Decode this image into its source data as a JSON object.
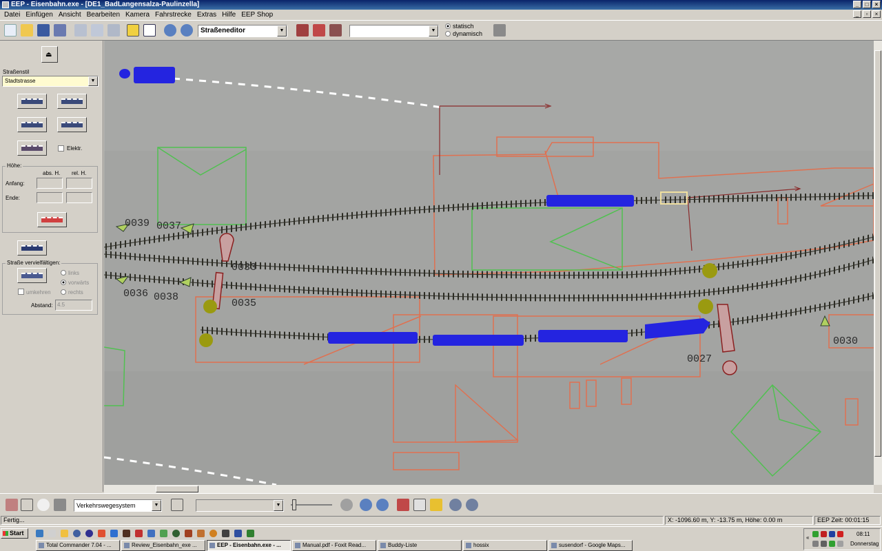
{
  "window": {
    "title": "EEP - Eisenbahn.exe - [DE1_BadLangensalza-Paulinzella]"
  },
  "menu": [
    "Datei",
    "Einfügen",
    "Ansicht",
    "Bearbeiten",
    "Kamera",
    "Fahrstrecke",
    "Extras",
    "Hilfe",
    "EEP Shop"
  ],
  "toolbar": {
    "editor_select": "Straßeneditor",
    "layer_select": "",
    "mode_static": "statisch",
    "mode_dynamic": "dynamisch",
    "mode_selected": "statisch"
  },
  "left_panel": {
    "road_style_label": "Straßenstil",
    "road_style_value": "Stadtstrasse",
    "electric_label": "Elektr.",
    "height_group": "Höhe:",
    "abs_label": "abs. H.",
    "rel_label": "rel. H.",
    "start_label": "Anfang:",
    "end_label": "Ende:",
    "duplicate_group": "Straße vervielfältigen:",
    "left_label": "links",
    "forward_label": "vorwärts",
    "right_label": "rechts",
    "reverse_label": "umkehren",
    "distance_label": "Abstand:",
    "distance_value": "4.5"
  },
  "viewport": {
    "track_labels": [
      "0039",
      "0037",
      "0033",
      "0035",
      "0036",
      "0038",
      "0027",
      "0030"
    ],
    "colors": {
      "ground": "#a3a4a2",
      "track": "#2c2c24",
      "train": "#2424e0",
      "building_outline": "#e07050",
      "green_outline": "#50c050",
      "signal": "#8a2020",
      "marker": "#9a9a10"
    }
  },
  "bottom_bar": {
    "system_select": "Verkehrswegesystem",
    "second_select": ""
  },
  "status": {
    "text": "Fertig...",
    "coords": "X: -1096.60 m, Y: -13.75 m, Höhe: 0.00 m",
    "eep_time": "EEP Zeit: 00:01:15"
  },
  "taskbar": {
    "start": "Start",
    "tasks": [
      "Total Commander 7.04 - ...",
      "Review_Eisenbahn_exe ...",
      "EEP - Eisenbahn.exe - ...",
      "Manual.pdf - Foxit Read...",
      "Buddy-Liste",
      "hossix",
      "susendorf - Google Maps..."
    ],
    "active_task": "EEP - Eisenbahn.exe - ...",
    "clock": "08:11",
    "day": "Donnerstag"
  }
}
